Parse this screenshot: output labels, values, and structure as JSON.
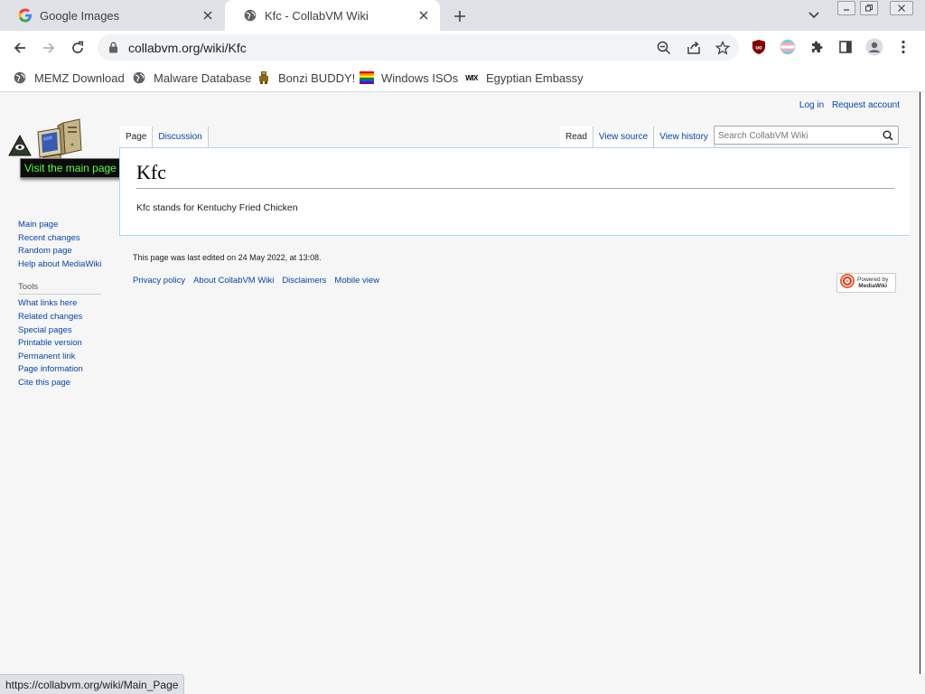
{
  "browser": {
    "tabs": [
      {
        "title": "Google Images",
        "icon": "google-g-icon",
        "active": false
      },
      {
        "title": "Kfc - CollabVM Wiki",
        "icon": "globe-icon",
        "active": true
      }
    ],
    "url": "collabvm.org/wiki/Kfc",
    "bookmarks": [
      {
        "label": "MEMZ Download",
        "icon": "globe-icon"
      },
      {
        "label": "Malware Database",
        "icon": "globe-icon"
      },
      {
        "label": "Bonzi BUDDY!",
        "icon": "bonzi-icon"
      },
      {
        "label": "Windows ISOs",
        "icon": "windows-flag-icon"
      },
      {
        "label": "Egyptian Embassy",
        "icon": "wix-icon"
      }
    ],
    "status_url": "https://collabvm.org/wiki/Main_Page",
    "colors": {
      "tabstrip": "#dee1e6",
      "omnibox": "#f1f3f4",
      "ublock": "#800000"
    }
  },
  "wiki": {
    "personal": {
      "login": "Log in",
      "request": "Request account"
    },
    "logo_tooltip": "Visit the main page",
    "nav": [
      "Main page",
      "Recent changes",
      "Random page",
      "Help about MediaWiki"
    ],
    "tools_heading": "Tools",
    "tools": [
      "What links here",
      "Related changes",
      "Special pages",
      "Printable version",
      "Permanent link",
      "Page information",
      "Cite this page"
    ],
    "tabs_left": {
      "page": "Page",
      "discussion": "Discussion"
    },
    "tabs_right": {
      "read": "Read",
      "view_source": "View source",
      "view_history": "View history"
    },
    "search_placeholder": "Search CollabVM Wiki",
    "heading": "Kfc",
    "body": "Kfc stands for Kentuchy Fried Chicken",
    "footer_info": "This page was last edited on 24 May 2022, at 13:08.",
    "footer_links": [
      "Privacy policy",
      "About CollabVM Wiki",
      "Disclaimers",
      "Mobile view"
    ],
    "powered_by": "Powered by",
    "powered_name": "MediaWiki",
    "colors": {
      "link": "#0645ad",
      "content_border": "#a7d7f9",
      "tooltip_text": "#5cff3a"
    }
  }
}
